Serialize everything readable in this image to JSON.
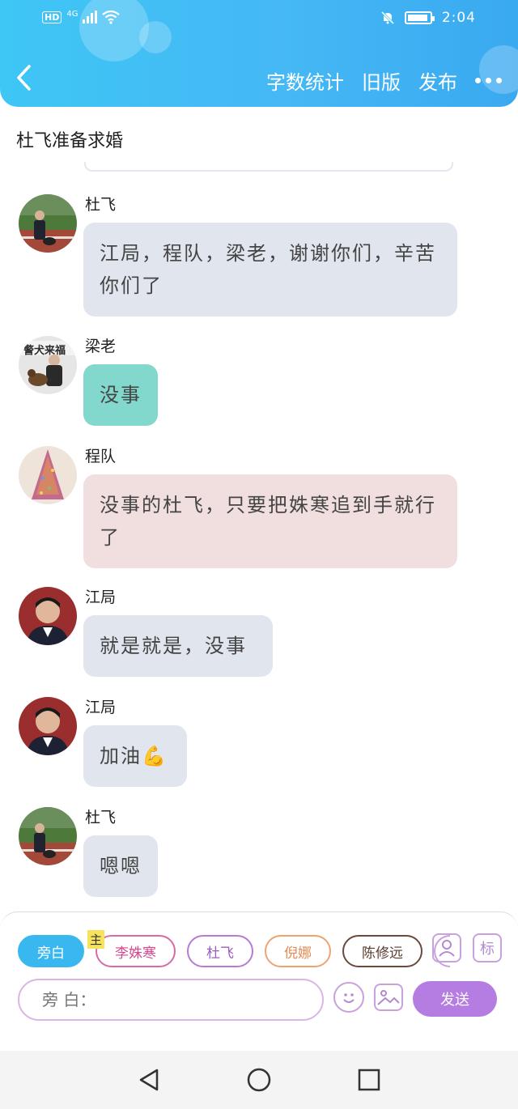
{
  "status_bar": {
    "hd": "HD",
    "network": "4G",
    "time": "2:04"
  },
  "header": {
    "actions": [
      "字数统计",
      "旧版",
      "发布"
    ]
  },
  "doc_title": "杜飞准备求婚",
  "messages": [
    {
      "name": "杜飞",
      "text": "江局，程队，梁老，谢谢你们，辛苦你们了",
      "style": "gray",
      "avatar": "dufei"
    },
    {
      "name": "梁老",
      "text": "没事",
      "style": "teal",
      "avatar": "lianglao"
    },
    {
      "name": "程队",
      "text": "没事的杜飞，只要把姝寒追到手就行了",
      "style": "pink",
      "avatar": "chengdui"
    },
    {
      "name": "江局",
      "text": "就是就是，没事",
      "style": "gray",
      "avatar": "jiangju"
    },
    {
      "name": "江局",
      "text": "加油",
      "emoji": "💪",
      "style": "gray",
      "avatar": "jiangju"
    },
    {
      "name": "杜飞",
      "text": "嗯嗯",
      "style": "gray",
      "avatar": "dufei"
    }
  ],
  "roles": {
    "narrator": "旁白",
    "main_tag": "主",
    "chars": [
      "李姝寒",
      "杜飞",
      "倪娜",
      "陈修远"
    ]
  },
  "side_icons": {
    "biao": "标"
  },
  "input": {
    "placeholder": "旁 白："
  },
  "send_label": "发送",
  "colors": {
    "header": "#3ec6f5",
    "send": "#b57de2",
    "narrator_chip": "#39b8ef"
  }
}
